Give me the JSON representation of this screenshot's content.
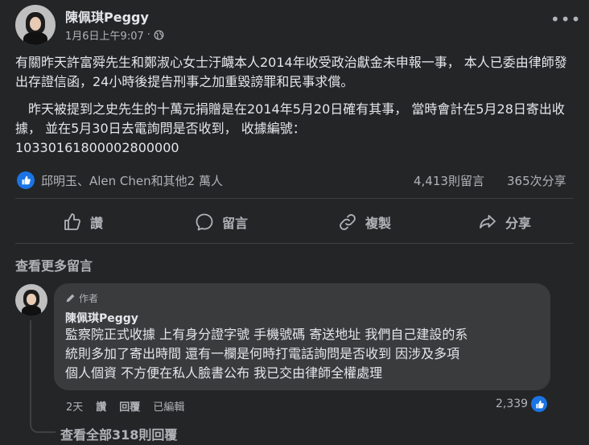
{
  "post": {
    "author": "陳佩琪Peggy",
    "timestamp": "1月6日上午9:07",
    "separator": "·",
    "more_icon": "more-horizontal-icon",
    "paragraph1": "有關昨天許富舜先生和鄭淑心女士汙衊本人2014年收受政治獻金未申報一事， 本人已委由律師發出存證信函，24小時後提告刑事之加重毀謗罪和民事求償。",
    "paragraph2": "　昨天被提到之史先生的十萬元捐贈是在2014年5月20日確有其事， 當時會計在5月28日寄出收據， 並在5月30日去電詢問是否收到， 收據編號：",
    "paragraph3": "10330161800002800000"
  },
  "stats": {
    "reactors": "邱明玉、Alen Chen和其他2 萬人",
    "comments": "4,413則留言",
    "shares": "365次分享"
  },
  "actions": {
    "like": "讚",
    "comment": "留言",
    "copy": "複製",
    "share": "分享"
  },
  "see_more_comments": "查看更多留言",
  "comment": {
    "author_tag": "作者",
    "name": "陳佩琪Peggy",
    "line1": "監察院正式收據 上有身分證字號 手機號碼 寄送地址 我們自己建設的系",
    "line2": "統則多加了寄出時間 還有一欄是何時打電話詢問是否收到 因涉及多項",
    "line3": "個人個資 不方便在私人臉書公布 我已交由律師全權處理",
    "age": "2天",
    "like": "讚",
    "reply": "回覆",
    "edited": "已編輯",
    "like_count": "2,339"
  },
  "view_all_replies": "查看全部318則回覆",
  "colors": {
    "background": "#242526",
    "bubble": "#3a3b3c",
    "accent": "#1b74e4",
    "text": "#e4e6eb",
    "secondary": "#b0b3b8"
  }
}
